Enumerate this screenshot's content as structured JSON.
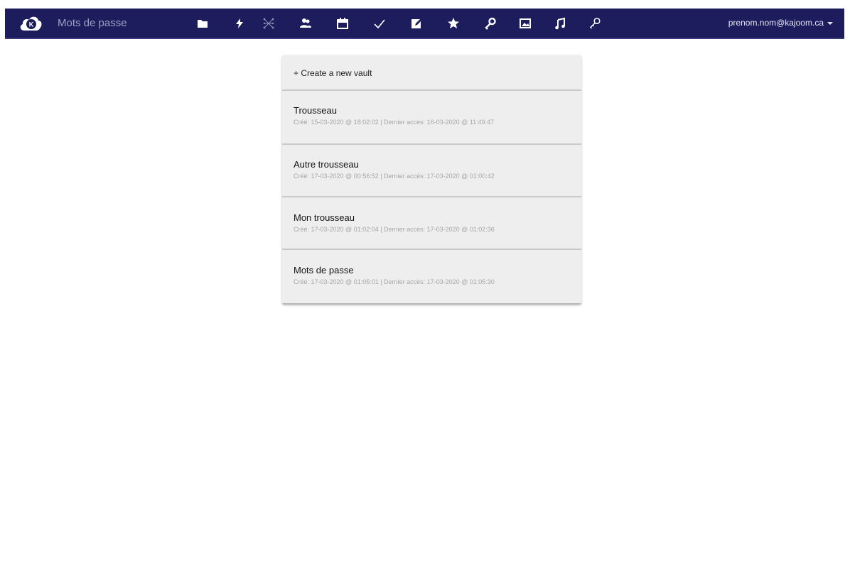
{
  "app": {
    "title": "Mots de passe",
    "logo_letter": "K",
    "logo_icon": "cloud-icon",
    "user_email": "prenom.nom@kajoom.ca"
  },
  "nav_icons": [
    {
      "name": "folder-icon"
    },
    {
      "name": "lightning-icon"
    },
    {
      "name": "network-icon"
    },
    {
      "name": "contacts-icon"
    },
    {
      "name": "calendar-icon"
    },
    {
      "name": "checkmark-icon"
    },
    {
      "name": "notes-icon"
    },
    {
      "name": "star-icon"
    },
    {
      "name": "key-icon"
    },
    {
      "name": "gallery-icon"
    },
    {
      "name": "music-icon"
    },
    {
      "name": "password-key-icon"
    }
  ],
  "vaults": {
    "create_label": "+ Create a new vault",
    "items": [
      {
        "name": "Trousseau",
        "meta": "Créé: 15-03-2020 @ 18:02:02 | Dernier accès: 16-03-2020 @ 11:49:47"
      },
      {
        "name": "Autre trousseau",
        "meta": "Créé: 17-03-2020 @ 00:56:52 | Dernier accès: 17-03-2020 @ 01:00:42"
      },
      {
        "name": "Mon trousseau",
        "meta": "Créé: 17-03-2020 @ 01:02:04 | Dernier accès: 17-03-2020 @ 01:02:36"
      },
      {
        "name": "Mots de passe",
        "meta": "Créé: 17-03-2020 @ 01:05:01 | Dernier accès: 17-03-2020 @ 01:05:30"
      }
    ]
  },
  "colors": {
    "topbar": "#1d1d5e",
    "panel": "#eeeeee",
    "divider": "#c9c9c9"
  }
}
